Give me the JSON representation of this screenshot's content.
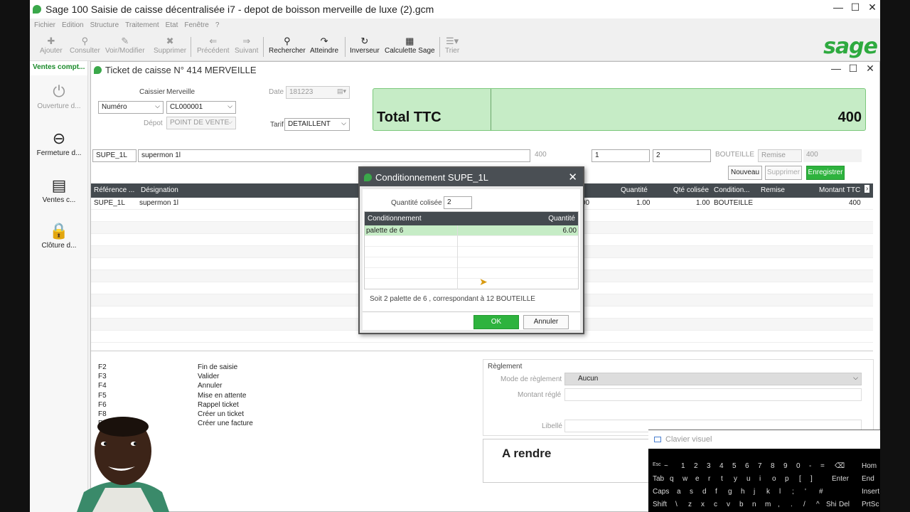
{
  "window": {
    "title": "Sage 100 Saisie de caisse décentralisée i7 - depot de boisson merveille de luxe (2).gcm",
    "controls": [
      "—",
      "☐",
      "✕"
    ]
  },
  "menu": [
    "Fichier",
    "Edition",
    "Structure",
    "Traitement",
    "Etat",
    "Fenêtre",
    "?"
  ],
  "toolbar": {
    "ajouter": "Ajouter",
    "consulter": "Consulter",
    "voir": "Voir/Modifier",
    "supprimer": "Supprimer",
    "precedent": "Précédent",
    "suivant": "Suivant",
    "rechercher": "Rechercher",
    "atteindre": "Atteindre",
    "inverseur": "Inverseur",
    "calculette": "Calculette Sage",
    "trier": "Trier"
  },
  "logo": "sage",
  "side": {
    "head": "Ventes compt...",
    "items": [
      "Ouverture d...",
      "Fermeture d...",
      "Ventes c...",
      "Clôture d..."
    ]
  },
  "ticket": {
    "title": "Ticket de caisse N° 414 MERVEILLE",
    "caissier_label": "Caissier",
    "caissier_value": "Merveille",
    "numero": "Numéro",
    "client": "CL000001",
    "date_label": "Date",
    "date_value": "181223",
    "depot_label": "Dépot",
    "depot_value": "POINT DE VENTE",
    "tarif_label": "Tarif",
    "tarif_value": "DETAILLENT",
    "total_label": "Total TTC",
    "total_value": "400"
  },
  "entry": {
    "ref": "SUPE_1L",
    "designation": "supermon 1l",
    "price": "400",
    "qty": "1",
    "qty_col": "2",
    "cond": "BOUTEILLE",
    "remise": "Remise",
    "montant": "400"
  },
  "actions": {
    "nouveau": "Nouveau",
    "supprimer": "Supprimer",
    "enregistrer": "Enregistrer"
  },
  "grid": {
    "headers": [
      "Référence ...",
      "Désignation",
      "Quantité",
      "Qté colisée",
      "Condition...",
      "Remise",
      "Montant TTC"
    ],
    "row": {
      "ref": "SUPE_1L",
      "designation": "supermon 1l",
      "partial": "00",
      "quantite": "1.00",
      "qte_colisee": "1.00",
      "condition": "BOUTEILLE",
      "remise": "",
      "montant": "400"
    }
  },
  "shortcuts": [
    {
      "key": "F2",
      "label": "Fin de saisie"
    },
    {
      "key": "F3",
      "label": "Valider"
    },
    {
      "key": "F4",
      "label": "Annuler"
    },
    {
      "key": "F5",
      "label": "Mise en attente"
    },
    {
      "key": "F6",
      "label": "Rappel ticket"
    },
    {
      "key": "F8",
      "label": "Créer un ticket"
    },
    {
      "key": "F",
      "label": "Créer une facture"
    }
  ],
  "reglement": {
    "title": "Règlement",
    "mode_label": "Mode de règlement",
    "mode_value": "Aucun",
    "montant_label": "Montant réglé",
    "libelle_label": "Libellé"
  },
  "arendre": "A rendre",
  "dialog": {
    "title": "Conditionnement SUPE_1L",
    "qty_label": "Quantité colisée",
    "qty_value": "2",
    "col_cond": "Conditionnement",
    "col_qty": "Quantité",
    "row_cond": "palette de 6",
    "row_qty": "6.00",
    "summary": "Soit 2 palette de 6 , correspondant à 12 BOUTEILLE",
    "ok": "OK",
    "annuler": "Annuler"
  },
  "keyboard": {
    "title": "Clavier visuel",
    "row1": [
      "Esc",
      "~",
      "1",
      "2",
      "3",
      "4",
      "5",
      "6",
      "7",
      "8",
      "9",
      "0",
      "-",
      "=",
      "⌫",
      "Hom"
    ],
    "row2": [
      "Tab",
      "q",
      "w",
      "e",
      "r",
      "t",
      "y",
      "u",
      "i",
      "o",
      "p",
      "[",
      "]",
      "Enter",
      "End"
    ],
    "row3": [
      "Caps",
      "a",
      "s",
      "d",
      "f",
      "g",
      "h",
      "j",
      "k",
      "l",
      ";",
      "'",
      "#",
      "Insert"
    ],
    "row4": [
      "Shift",
      "\\",
      "z",
      "x",
      "c",
      "v",
      "b",
      "n",
      "m",
      ",",
      ".",
      "/",
      "^",
      "Shi",
      "Del",
      "PrtSc"
    ]
  },
  "colors": {
    "accent": "#2eb33e",
    "total_bg": "#c6ecc6",
    "header_bg": "#444a4f"
  }
}
